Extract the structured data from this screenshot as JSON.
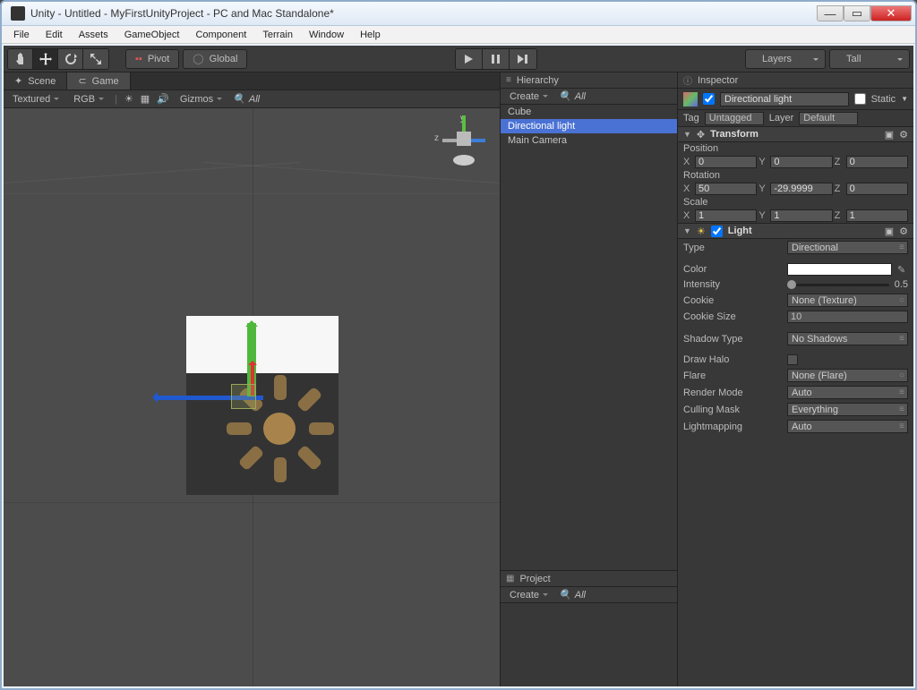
{
  "window": {
    "title": "Unity - Untitled - MyFirstUnityProject - PC and Mac Standalone*"
  },
  "menu": [
    "File",
    "Edit",
    "Assets",
    "GameObject",
    "Component",
    "Terrain",
    "Window",
    "Help"
  ],
  "toolbar": {
    "pivot": "Pivot",
    "global": "Global",
    "layers": "Layers",
    "layout": "Tall"
  },
  "tabs": {
    "scene": "Scene",
    "game": "Game"
  },
  "sceneTb": {
    "shading": "Textured",
    "render": "RGB",
    "gizmos": "Gizmos",
    "search": "All"
  },
  "axis": {
    "y": "y",
    "z": "z"
  },
  "hierarchy": {
    "title": "Hierarchy",
    "create": "Create",
    "search": "All",
    "items": [
      "Cube",
      "Directional light",
      "Main Camera"
    ],
    "selected": 1
  },
  "project": {
    "title": "Project",
    "create": "Create",
    "search": "All"
  },
  "inspector": {
    "title": "Inspector",
    "name": "Directional light",
    "static": "Static",
    "tagLabel": "Tag",
    "tag": "Untagged",
    "layerLabel": "Layer",
    "layer": "Default",
    "transform": {
      "title": "Transform",
      "position": {
        "label": "Position",
        "x": "0",
        "y": "0",
        "z": "0"
      },
      "rotation": {
        "label": "Rotation",
        "x": "50",
        "y": "-29.9999",
        "z": "0"
      },
      "scale": {
        "label": "Scale",
        "x": "1",
        "y": "1",
        "z": "1"
      }
    },
    "light": {
      "title": "Light",
      "type": {
        "label": "Type",
        "value": "Directional"
      },
      "color": {
        "label": "Color",
        "value": "#ffffff"
      },
      "intensity": {
        "label": "Intensity",
        "value": "0.5",
        "pct": 50
      },
      "cookie": {
        "label": "Cookie",
        "value": "None (Texture)"
      },
      "cookieSize": {
        "label": "Cookie Size",
        "value": "10"
      },
      "shadowType": {
        "label": "Shadow Type",
        "value": "No Shadows"
      },
      "drawHalo": {
        "label": "Draw Halo",
        "value": false
      },
      "flare": {
        "label": "Flare",
        "value": "None (Flare)"
      },
      "renderMode": {
        "label": "Render Mode",
        "value": "Auto"
      },
      "cullingMask": {
        "label": "Culling Mask",
        "value": "Everything"
      },
      "lightmapping": {
        "label": "Lightmapping",
        "value": "Auto"
      }
    }
  }
}
